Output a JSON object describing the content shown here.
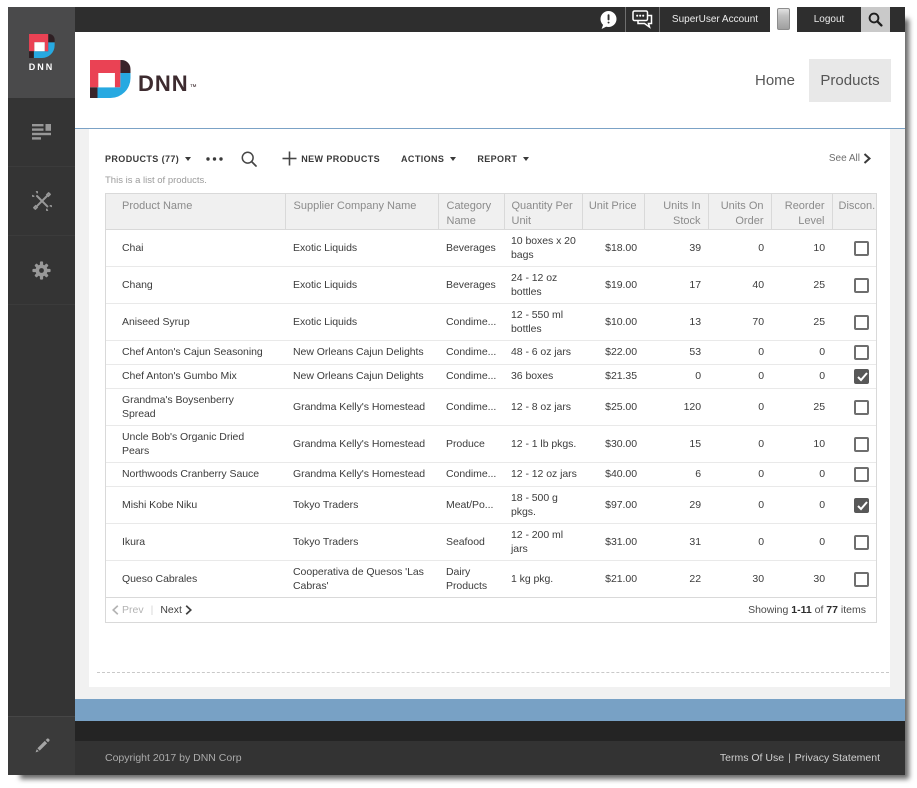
{
  "topbar": {
    "account_label": "SuperUser Account",
    "logout_label": "Logout",
    "alert_icon": "alert-bubble-icon",
    "chat_icon": "messages-icon",
    "search_icon": "search-icon"
  },
  "personabar": {
    "logo_text": "DNN",
    "items": [
      {
        "name": "content",
        "icon": "content-pages-icon"
      },
      {
        "name": "tools",
        "icon": "crossed-tools-icon"
      },
      {
        "name": "settings",
        "icon": "gear-icon"
      }
    ],
    "edit_icon": "pencil-icon"
  },
  "siteheader": {
    "brand": "DNN",
    "trademark": "™",
    "nav": [
      {
        "label": "Home",
        "active": false
      },
      {
        "label": "Products",
        "active": true
      }
    ]
  },
  "module": {
    "title": "PRODUCTS (77)",
    "more_icon": "ellipsis-icon",
    "search_icon": "search-icon",
    "new_label": "NEW PRODUCTS",
    "actions_label": "ACTIONS",
    "report_label": "REPORT",
    "see_all_label": "See All",
    "description": "This is a list of products."
  },
  "table": {
    "columns": [
      {
        "key": "product",
        "label": "Product Name",
        "width": 179,
        "align": "left"
      },
      {
        "key": "supplier",
        "label": "Supplier Company Name",
        "width": 153,
        "align": "left"
      },
      {
        "key": "category",
        "label": "Category Name",
        "width": 66,
        "align": "left"
      },
      {
        "key": "quantity",
        "label": "Quantity Per Unit",
        "width": 78,
        "align": "left"
      },
      {
        "key": "price",
        "label": "Unit Price",
        "width": 62,
        "align": "right"
      },
      {
        "key": "stock",
        "label": "Units In Stock",
        "width": 64,
        "align": "right"
      },
      {
        "key": "order",
        "label": "Units On Order",
        "width": 63,
        "align": "right"
      },
      {
        "key": "reorder",
        "label": "Reorder Level",
        "width": 61,
        "align": "right"
      },
      {
        "key": "discontinued",
        "label": "Discon...",
        "width": 44,
        "align": "left"
      }
    ],
    "rows": [
      {
        "product": "Chai",
        "supplier": "Exotic Liquids",
        "category": "Beverages",
        "quantity": "10 boxes x 20 bags",
        "price": "$18.00",
        "stock": "39",
        "order": "0",
        "reorder": "10",
        "discontinued": false
      },
      {
        "product": "Chang",
        "supplier": "Exotic Liquids",
        "category": "Beverages",
        "quantity": "24 - 12 oz bottles",
        "price": "$19.00",
        "stock": "17",
        "order": "40",
        "reorder": "25",
        "discontinued": false
      },
      {
        "product": "Aniseed Syrup",
        "supplier": "Exotic Liquids",
        "category": "Condime...",
        "quantity": "12 - 550 ml bottles",
        "price": "$10.00",
        "stock": "13",
        "order": "70",
        "reorder": "25",
        "discontinued": false
      },
      {
        "product": "Chef Anton's Cajun Seasoning",
        "supplier": "New Orleans Cajun Delights",
        "category": "Condime...",
        "quantity": "48 - 6 oz jars",
        "price": "$22.00",
        "stock": "53",
        "order": "0",
        "reorder": "0",
        "discontinued": false
      },
      {
        "product": "Chef Anton's Gumbo Mix",
        "supplier": "New Orleans Cajun Delights",
        "category": "Condime...",
        "quantity": "36 boxes",
        "price": "$21.35",
        "stock": "0",
        "order": "0",
        "reorder": "0",
        "discontinued": true
      },
      {
        "product": "Grandma's Boysenberry Spread",
        "supplier": "Grandma Kelly's Homestead",
        "category": "Condime...",
        "quantity": "12 - 8 oz jars",
        "price": "$25.00",
        "stock": "120",
        "order": "0",
        "reorder": "25",
        "discontinued": false
      },
      {
        "product": "Uncle Bob's Organic Dried Pears",
        "supplier": "Grandma Kelly's Homestead",
        "category": "Produce",
        "quantity": "12 - 1 lb pkgs.",
        "price": "$30.00",
        "stock": "15",
        "order": "0",
        "reorder": "10",
        "discontinued": false
      },
      {
        "product": "Northwoods Cranberry Sauce",
        "supplier": "Grandma Kelly's Homestead",
        "category": "Condime...",
        "quantity": "12 - 12 oz jars",
        "price": "$40.00",
        "stock": "6",
        "order": "0",
        "reorder": "0",
        "discontinued": false
      },
      {
        "product": "Mishi Kobe Niku",
        "supplier": "Tokyo Traders",
        "category": "Meat/Po...",
        "quantity": "18 - 500 g pkgs.",
        "price": "$97.00",
        "stock": "29",
        "order": "0",
        "reorder": "0",
        "discontinued": true
      },
      {
        "product": "Ikura",
        "supplier": "Tokyo Traders",
        "category": "Seafood",
        "quantity": "12 - 200 ml jars",
        "price": "$31.00",
        "stock": "31",
        "order": "0",
        "reorder": "0",
        "discontinued": false
      },
      {
        "product": "Queso Cabrales",
        "supplier": "Cooperativa de Quesos 'Las Cabras'",
        "category": "Dairy Products",
        "quantity": "1 kg pkg.",
        "price": "$21.00",
        "stock": "22",
        "order": "30",
        "reorder": "30",
        "discontinued": false
      }
    ]
  },
  "pagination": {
    "prev_label": "Prev",
    "next_label": "Next",
    "divider": "|",
    "showing": [
      {
        "text": "Showing ",
        "bold": false
      },
      {
        "text": "1-11",
        "bold": true
      },
      {
        "text": " of ",
        "bold": false
      },
      {
        "text": "77",
        "bold": true
      },
      {
        "text": " items",
        "bold": false
      }
    ]
  },
  "footer": {
    "copyright": "Copyright 2017 by DNN Corp",
    "terms_label": "Terms Of Use",
    "separator": "|",
    "privacy_label": "Privacy Statement"
  },
  "colors": {
    "topbar_bg": "#2e2e2e",
    "personabar_bg": "#343434",
    "accent_bar": "#78a1c5",
    "footer_bg": "#333333",
    "active_nav_bg": "#e8e8e8",
    "logo_red": "#ea4254",
    "logo_blue": "#27a9e1",
    "logo_dark": "#38242a"
  }
}
